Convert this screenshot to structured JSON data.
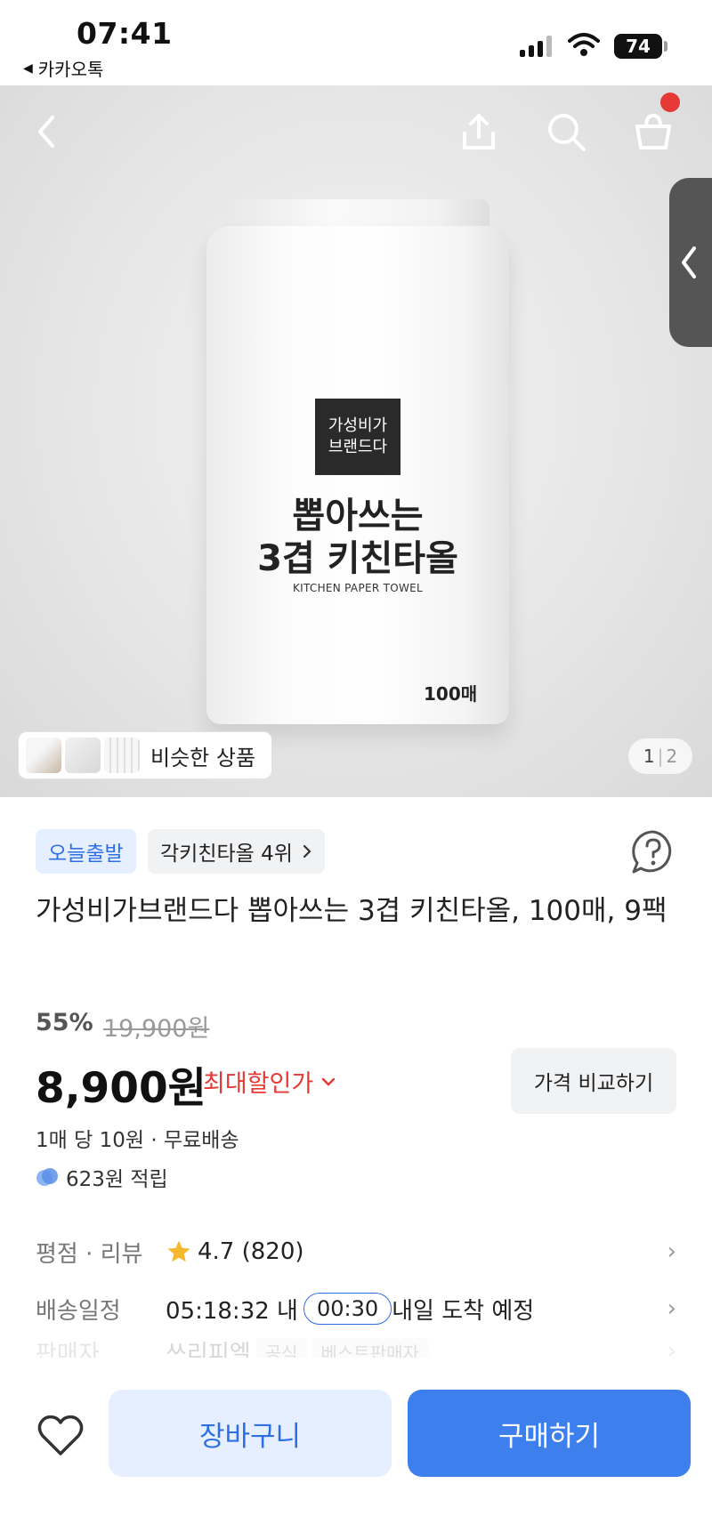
{
  "status_bar": {
    "time": "07:41",
    "back_app": "카카오톡",
    "battery": "74"
  },
  "hero": {
    "similar_label": "비슷한 상품",
    "pager_current": "1",
    "pager_total": "2",
    "package": {
      "brand_line1": "가성비가",
      "brand_line2": "브랜드다",
      "title_line1": "뽑아쓰는",
      "title_line2": "3겹 키친타올",
      "subtitle": "KITCHEN PAPER TOWEL",
      "count": "100매"
    }
  },
  "badges": {
    "today_ship": "오늘출발",
    "rank": "각키친타올 4위"
  },
  "product": {
    "title": "가성비가브랜드다 뽑아쓰는 3겹 키친타올, 100매, 9팩",
    "discount_rate": "55%",
    "original_price": "19,900원",
    "price": "8,900원",
    "max_discount_label": "최대할인가",
    "compare_button": "가격 비교하기",
    "per_unit": "1매 당 10원 · 무료배송",
    "points": "623원 적립"
  },
  "info_rows": {
    "rating_key": "평점 · 리뷰",
    "rating_value": "4.7 (820)",
    "delivery_key": "배송일정",
    "delivery_time": "05:18:32 내",
    "delivery_timer": "00:30",
    "delivery_value": "내일 도착 예정",
    "seller_key": "판매자",
    "seller_value": "쓰리피엘",
    "seller_tag1": "공식",
    "seller_tag2": "베스트판매자"
  },
  "bottom_bar": {
    "cart_label": "장바구니",
    "buy_label": "구매하기"
  },
  "colors": {
    "accent_blue": "#3e7fee",
    "accent_blue_light": "#e6efff",
    "discount_red": "#e53935",
    "star": "#f5b82e"
  }
}
